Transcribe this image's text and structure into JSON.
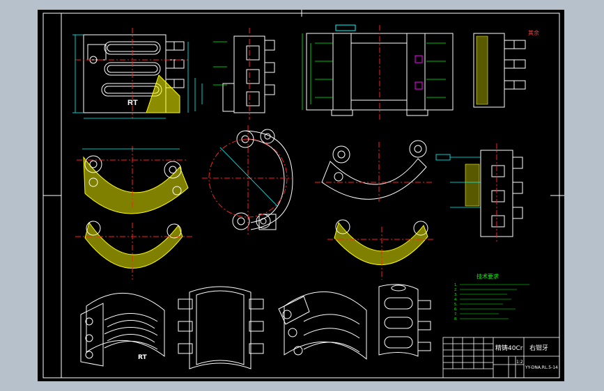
{
  "drawing": {
    "title_block": {
      "material": "精铸40Cr",
      "part_name": "右钳牙",
      "drawing_no": "YY-DNA.RL.5-14",
      "scale": "1:2"
    },
    "corner_note": "其余",
    "view_labels": {
      "rt_front": "RT",
      "rt_iso": "RT"
    },
    "tech_requirements": {
      "heading": "技术要求",
      "lines": [
        "1.",
        "2.",
        "3.",
        "4.",
        "5.",
        "6.",
        "7.",
        "8."
      ]
    },
    "colors": {
      "background": "#000000",
      "outer_frame": "#b7c1cb",
      "geometry": "#ffffff",
      "centerline": "#ff2020",
      "dimension": "#00ffff",
      "hatch": "#ffff00",
      "annotation": "#00ff00",
      "highlight": "#ff00ff"
    }
  }
}
